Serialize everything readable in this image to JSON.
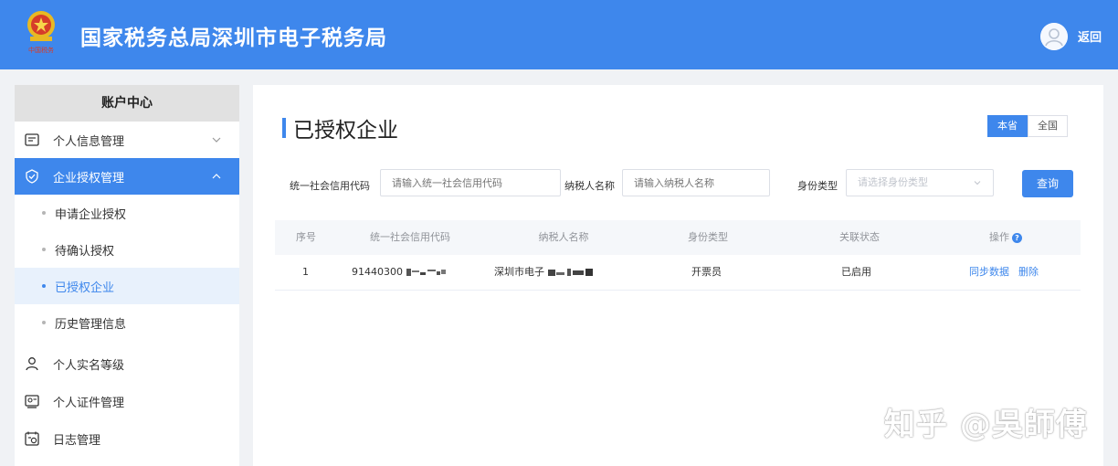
{
  "header": {
    "title": "国家税务总局深圳市电子税务局",
    "back_label": "返回",
    "emblem_text": "中国税务"
  },
  "sidebar": {
    "title": "账户中心",
    "items": [
      {
        "label": "个人信息管理",
        "icon": "id-card-icon",
        "expanded": false
      },
      {
        "label": "企业授权管理",
        "icon": "shield-check-icon",
        "expanded": true,
        "active": true
      },
      {
        "label": "申请企业授权",
        "sub": true
      },
      {
        "label": "待确认授权",
        "sub": true
      },
      {
        "label": "已授权企业",
        "sub": true,
        "active": true
      },
      {
        "label": "历史管理信息",
        "sub": true
      },
      {
        "label": "个人实名等级",
        "icon": "user-level-icon"
      },
      {
        "label": "个人证件管理",
        "icon": "certificate-icon"
      },
      {
        "label": "日志管理",
        "icon": "log-icon"
      }
    ]
  },
  "main": {
    "title": "已授权企业",
    "scope_tabs": [
      {
        "label": "本省",
        "selected": true
      },
      {
        "label": "全国",
        "selected": false
      }
    ],
    "filters": {
      "credit_code": {
        "label": "统一社会信用代码",
        "placeholder": "请输入统一社会信用代码"
      },
      "taxpayer_name": {
        "label": "纳税人名称",
        "placeholder": "请输入纳税人名称"
      },
      "identity_type": {
        "label": "身份类型",
        "placeholder": "请选择身份类型"
      },
      "query_label": "查询"
    },
    "table": {
      "columns": [
        "序号",
        "统一社会信用代码",
        "纳税人名称",
        "身份类型",
        "关联状态",
        "操作"
      ],
      "rows": [
        {
          "index": "1",
          "credit_code_visible": "91440300",
          "taxpayer_name_visible": "深圳市电子",
          "identity_type": "开票员",
          "status": "已启用",
          "actions": [
            "同步数据",
            "删除"
          ]
        }
      ]
    }
  },
  "watermark": "知乎 @吳師傅",
  "colors": {
    "primary": "#3e87ec",
    "header_bg": "#3e87ec",
    "page_bg": "#f0f2f5"
  }
}
